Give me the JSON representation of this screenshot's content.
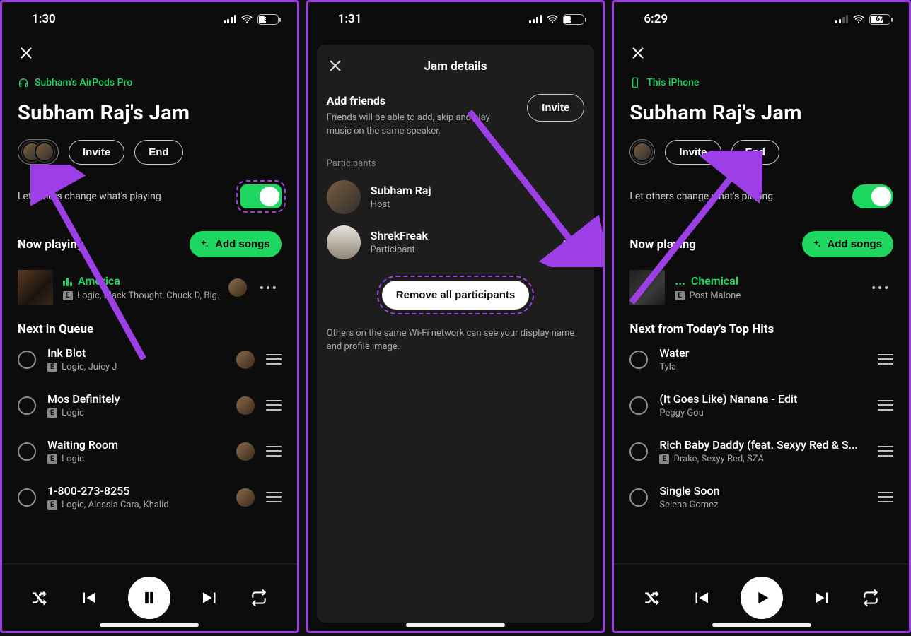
{
  "colors": {
    "accent": "#1ed760",
    "highlight": "#9d3fe7"
  },
  "screen1": {
    "status": {
      "time": "1:30",
      "battery_pct": "38"
    },
    "device_label": "Subham's AirPods Pro",
    "title": "Subham Raj's Jam",
    "buttons": {
      "invite": "Invite",
      "end": "End"
    },
    "toggle_label": "Let others change what's playing",
    "now_playing_heading": "Now playing",
    "add_label": "Add songs",
    "now_playing": {
      "title": "America",
      "subtitle": "Logic, Black Thought, Chuck D, Big..."
    },
    "queue_heading": "Next in Queue",
    "queue": [
      {
        "title": "Ink Blot",
        "subtitle": "Logic, Juicy J",
        "explicit": true
      },
      {
        "title": "Mos Definitely",
        "subtitle": "Logic",
        "explicit": true
      },
      {
        "title": "Waiting Room",
        "subtitle": "Logic",
        "explicit": true
      },
      {
        "title": "1-800-273-8255",
        "subtitle": "Logic, Alessia Cara, Khalid",
        "explicit": true
      }
    ]
  },
  "screen2": {
    "status": {
      "time": "1:31",
      "battery_pct": "38"
    },
    "title": "Jam details",
    "add_friends_heading": "Add friends",
    "add_friends_body": "Friends will be able to add, skip and play music on the same speaker.",
    "invite_label": "Invite",
    "participants_label": "Participants",
    "participants": [
      {
        "name": "Subham Raj",
        "role": "Host"
      },
      {
        "name": "ShrekFreak",
        "role": "Participant"
      }
    ],
    "remove_label": "Remove all participants",
    "footnote": "Others on the same Wi-Fi network can see your display name and profile image."
  },
  "screen3": {
    "status": {
      "time": "6:29",
      "battery_pct": "67"
    },
    "device_label": "This iPhone",
    "title": "Subham Raj's Jam",
    "buttons": {
      "invite": "Invite",
      "end": "End"
    },
    "toggle_label": "Let others change what's playing",
    "now_playing_heading": "Now playing",
    "add_label": "Add songs",
    "now_playing": {
      "title": "Chemical",
      "subtitle": "Post Malone"
    },
    "queue_heading": "Next from Today's Top Hits",
    "queue": [
      {
        "title": "Water",
        "subtitle": "Tyla",
        "explicit": false
      },
      {
        "title": "(It Goes Like) Nanana - Edit",
        "subtitle": "Peggy Gou",
        "explicit": false
      },
      {
        "title": "Rich Baby Daddy (feat. Sexyy Red & S...",
        "subtitle": "Drake, Sexyy Red, SZA",
        "explicit": true
      },
      {
        "title": "Single Soon",
        "subtitle": "Selena Gomez",
        "explicit": false
      }
    ]
  },
  "explicit_badge": "E"
}
